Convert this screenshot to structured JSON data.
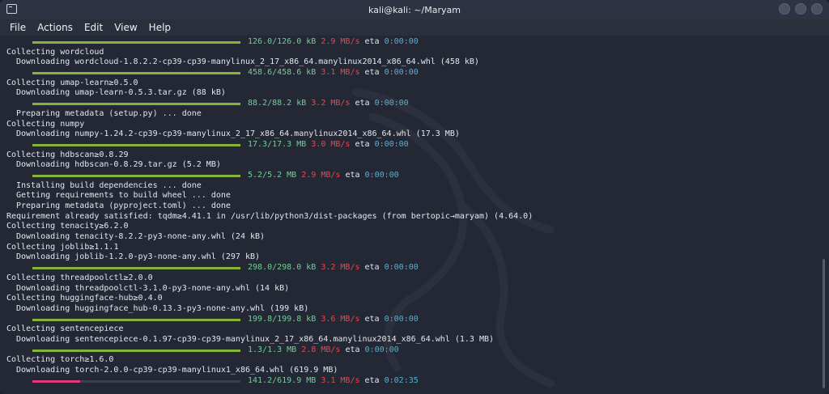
{
  "window": {
    "title": "kali@kali: ~/Maryam"
  },
  "menu": [
    "File",
    "Actions",
    "Edit",
    "View",
    "Help"
  ],
  "colors": {
    "bar": "#86b33a",
    "bar_partial": "#e3397a",
    "size": "#6fcf97",
    "speed": "#e5484d",
    "eta": "#4fb3d9"
  },
  "lines": [
    {
      "type": "bar",
      "progress": 1.0,
      "size": "126.0/126.0 kB",
      "speed": "2.9 MB/s",
      "eta": "0:00:00"
    },
    {
      "type": "text",
      "text": "Collecting wordcloud"
    },
    {
      "type": "text",
      "indent": true,
      "text": "Downloading wordcloud-1.8.2.2-cp39-cp39-manylinux_2_17_x86_64.manylinux2014_x86_64.whl (458 kB)"
    },
    {
      "type": "bar",
      "progress": 1.0,
      "size": "458.6/458.6 kB",
      "speed": "3.1 MB/s",
      "eta": "0:00:00"
    },
    {
      "type": "text",
      "text": "Collecting umap-learn≥0.5.0"
    },
    {
      "type": "text",
      "indent": true,
      "text": "Downloading umap-learn-0.5.3.tar.gz (88 kB)"
    },
    {
      "type": "bar",
      "progress": 1.0,
      "size": "88.2/88.2 kB",
      "speed": "3.2 MB/s",
      "eta": "0:00:00"
    },
    {
      "type": "text",
      "indent": true,
      "text": "Preparing metadata (setup.py) ... done"
    },
    {
      "type": "text",
      "text": "Collecting numpy"
    },
    {
      "type": "text",
      "indent": true,
      "text": "Downloading numpy-1.24.2-cp39-cp39-manylinux_2_17_x86_64.manylinux2014_x86_64.whl (17.3 MB)"
    },
    {
      "type": "bar",
      "progress": 1.0,
      "size": "17.3/17.3 MB",
      "speed": "3.0 MB/s",
      "eta": "0:00:00"
    },
    {
      "type": "text",
      "text": "Collecting hdbscan≥0.8.29"
    },
    {
      "type": "text",
      "indent": true,
      "text": "Downloading hdbscan-0.8.29.tar.gz (5.2 MB)"
    },
    {
      "type": "bar",
      "progress": 1.0,
      "size": "5.2/5.2 MB",
      "speed": "2.9 MB/s",
      "eta": "0:00:00"
    },
    {
      "type": "text",
      "indent": true,
      "text": "Installing build dependencies ... done"
    },
    {
      "type": "text",
      "indent": true,
      "text": "Getting requirements to build wheel ... done"
    },
    {
      "type": "text",
      "indent": true,
      "text": "Preparing metadata (pyproject.toml) ... done"
    },
    {
      "type": "text",
      "text": "Requirement already satisfied: tqdm≥4.41.1 in /usr/lib/python3/dist-packages (from bertopic→maryam) (4.64.0)"
    },
    {
      "type": "text",
      "text": "Collecting tenacity≥6.2.0"
    },
    {
      "type": "text",
      "indent": true,
      "text": "Downloading tenacity-8.2.2-py3-none-any.whl (24 kB)"
    },
    {
      "type": "text",
      "text": "Collecting joblib≥1.1.1"
    },
    {
      "type": "text",
      "indent": true,
      "text": "Downloading joblib-1.2.0-py3-none-any.whl (297 kB)"
    },
    {
      "type": "bar",
      "progress": 1.0,
      "size": "298.0/298.0 kB",
      "speed": "3.2 MB/s",
      "eta": "0:00:00"
    },
    {
      "type": "text",
      "text": "Collecting threadpoolctl≥2.0.0"
    },
    {
      "type": "text",
      "indent": true,
      "text": "Downloading threadpoolctl-3.1.0-py3-none-any.whl (14 kB)"
    },
    {
      "type": "text",
      "text": "Collecting huggingface-hub≥0.4.0"
    },
    {
      "type": "text",
      "indent": true,
      "text": "Downloading huggingface_hub-0.13.3-py3-none-any.whl (199 kB)"
    },
    {
      "type": "bar",
      "progress": 1.0,
      "size": "199.8/199.8 kB",
      "speed": "3.6 MB/s",
      "eta": "0:00:00"
    },
    {
      "type": "text",
      "text": "Collecting sentencepiece"
    },
    {
      "type": "text",
      "indent": true,
      "text": "Downloading sentencepiece-0.1.97-cp39-cp39-manylinux_2_17_x86_64.manylinux2014_x86_64.whl (1.3 MB)"
    },
    {
      "type": "bar",
      "progress": 1.0,
      "size": "1.3/1.3 MB",
      "speed": "2.8 MB/s",
      "eta": "0:00:00"
    },
    {
      "type": "text",
      "text": "Collecting torch≥1.6.0"
    },
    {
      "type": "text",
      "indent": true,
      "text": "Downloading torch-2.0.0-cp39-cp39-manylinux1_x86_64.whl (619.9 MB)"
    },
    {
      "type": "bar",
      "progress": 0.23,
      "partial": true,
      "size": "141.2/619.9 MB",
      "speed": "3.1 MB/s",
      "eta": "0:02:35"
    }
  ]
}
